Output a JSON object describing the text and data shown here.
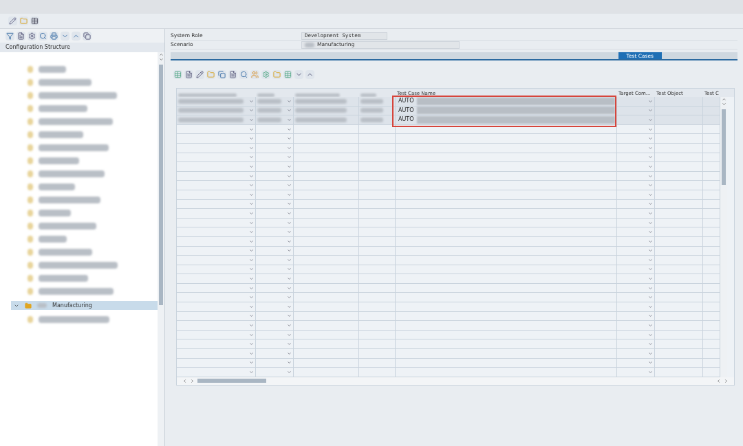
{
  "tree": {
    "header": "Configuration Structure",
    "items": [
      {
        "label": "Manufacturing",
        "expanded": true,
        "selected": true
      }
    ]
  },
  "form": [
    {
      "label": "System Role",
      "value": "Development System",
      "kind": "mono"
    },
    {
      "label": "Scenario",
      "value": "Manufacturing",
      "kind": "prefixed"
    }
  ],
  "tabs": [
    {
      "label": "Test Cases",
      "selected": true
    }
  ],
  "grid": {
    "columns": [
      {
        "kind": "dropdown"
      },
      {
        "kind": "dropdown"
      },
      {
        "kind": "text"
      },
      {
        "kind": "text"
      },
      {
        "label": "Test Case Name",
        "kind": "name"
      },
      {
        "label": "Target Com...",
        "kind": "dropdown"
      },
      {
        "label": "Test Object",
        "kind": "text"
      },
      {
        "label": "Test C",
        "kind": "text"
      }
    ],
    "rows": [
      {
        "test_case_name": "AUTO"
      },
      {
        "test_case_name": "AUTO"
      },
      {
        "test_case_name": "AUTO"
      }
    ]
  }
}
